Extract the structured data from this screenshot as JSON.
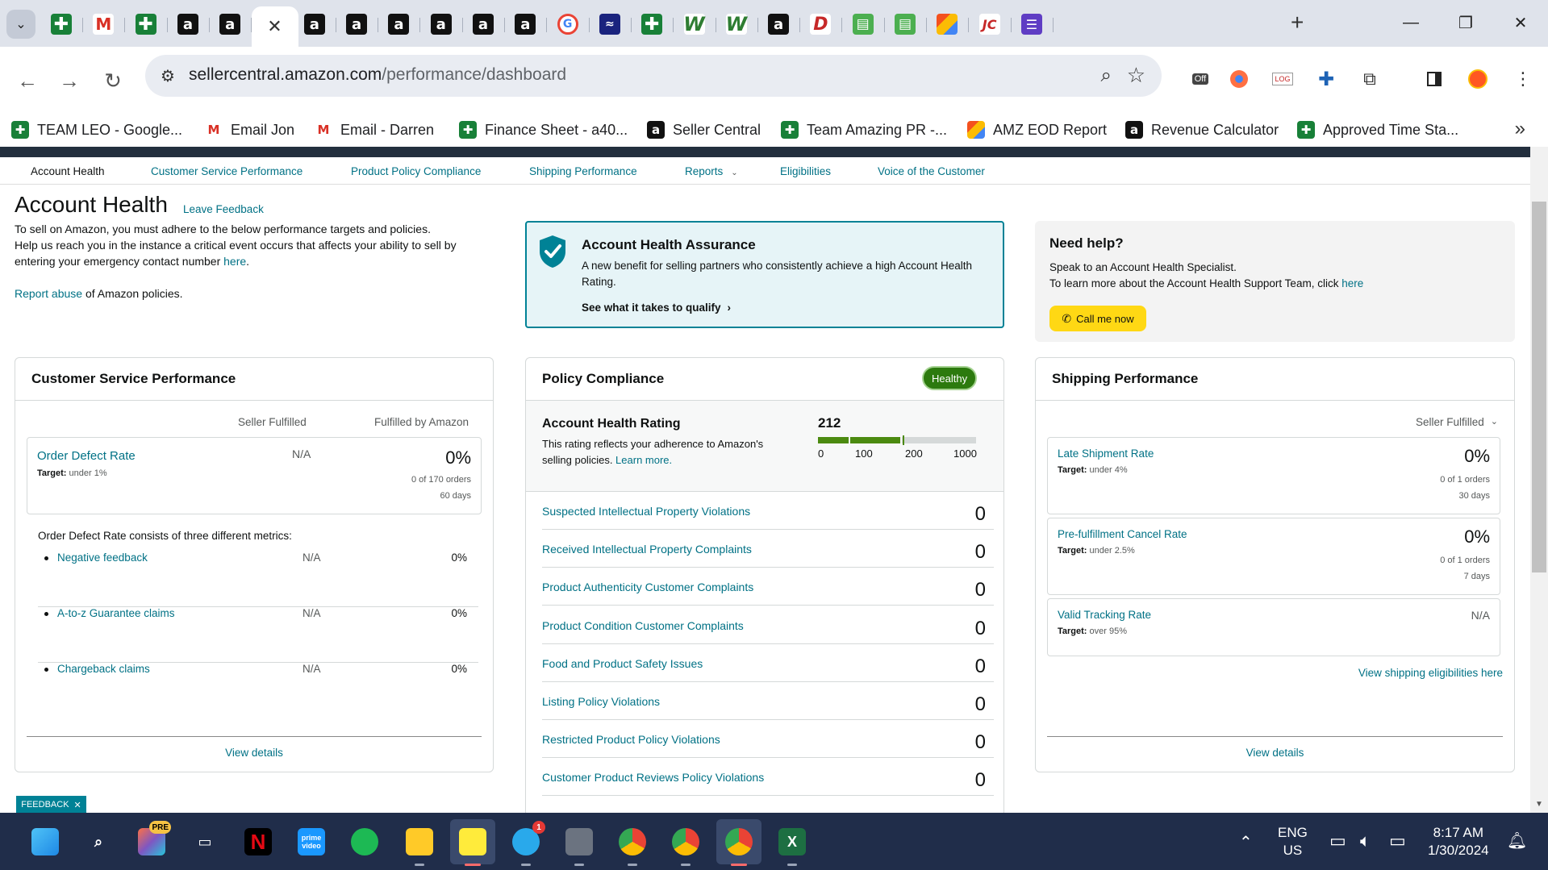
{
  "browser": {
    "tabs": [
      {
        "icon": "google-sheets-icon",
        "glyph": "✚",
        "style": "fav-sheets"
      },
      {
        "icon": "gmail-icon",
        "glyph": "M",
        "style": "fav-gmail"
      },
      {
        "icon": "google-sheets-icon",
        "glyph": "✚",
        "style": "fav-sheets"
      },
      {
        "icon": "amazon-icon",
        "glyph": "a",
        "style": "fav-amazon"
      },
      {
        "icon": "amazon-icon",
        "glyph": "a",
        "style": "fav-amazon"
      },
      {
        "icon": "active-tab",
        "glyph": "✕",
        "style": "tab-close",
        "active": true
      },
      {
        "icon": "amazon-icon",
        "glyph": "a",
        "style": "fav-amazon"
      },
      {
        "icon": "amazon-icon",
        "glyph": "a",
        "style": "fav-amazon"
      },
      {
        "icon": "amazon-icon",
        "glyph": "a",
        "style": "fav-amazon"
      },
      {
        "icon": "amazon-icon",
        "glyph": "a",
        "style": "fav-amazon"
      },
      {
        "icon": "amazon-icon",
        "glyph": "a",
        "style": "fav-amazon"
      },
      {
        "icon": "amazon-icon",
        "glyph": "a",
        "style": "fav-amazon"
      },
      {
        "icon": "google-icon",
        "glyph": "G",
        "style": "fav-google"
      },
      {
        "icon": "extension-icon",
        "glyph": "≈",
        "style": "fav-ext"
      },
      {
        "icon": "google-sheets-icon",
        "glyph": "✚",
        "style": "fav-sheets"
      },
      {
        "icon": "w-app-icon",
        "glyph": "W",
        "style": "fav-w"
      },
      {
        "icon": "w-app-icon",
        "glyph": "W",
        "style": "fav-w"
      },
      {
        "icon": "amazon-icon",
        "glyph": "a",
        "style": "fav-amazon"
      },
      {
        "icon": "d-app-icon",
        "glyph": "D",
        "style": "fav-d"
      },
      {
        "icon": "green-app-icon",
        "glyph": "▤",
        "style": "fav-green"
      },
      {
        "icon": "green-app-icon",
        "glyph": "▤",
        "style": "fav-green"
      },
      {
        "icon": "multicolor-app-icon",
        "glyph": "",
        "style": "fav-multi"
      },
      {
        "icon": "jc-app-icon",
        "glyph": "JC",
        "style": "fav-jc"
      },
      {
        "icon": "purple-list-icon",
        "glyph": "☰",
        "style": "fav-purple"
      }
    ],
    "url_host": "sellercentral.amazon.com",
    "url_path": "/performance/dashboard",
    "bookmarks": [
      {
        "label": "TEAM LEO - Google...",
        "icon": "google-sheets-icon",
        "glyph": "✚",
        "style": "fav-sheets"
      },
      {
        "label": "Email Jon",
        "icon": "gmail-icon",
        "glyph": "M",
        "style": "fav-gmail"
      },
      {
        "label": "Email - Darren",
        "icon": "gmail-icon",
        "glyph": "M",
        "style": "fav-gmail"
      },
      {
        "label": "Finance Sheet - a40...",
        "icon": "google-sheets-icon",
        "glyph": "✚",
        "style": "fav-sheets"
      },
      {
        "label": "Seller Central",
        "icon": "amazon-icon",
        "glyph": "a",
        "style": "fav-amazon"
      },
      {
        "label": "Team Amazing PR -...",
        "icon": "google-sheets-icon",
        "glyph": "✚",
        "style": "fav-sheets"
      },
      {
        "label": "AMZ EOD Report",
        "icon": "multicolor-app-icon",
        "glyph": "",
        "style": "fav-multi"
      },
      {
        "label": "Revenue Calculator",
        "icon": "amazon-icon",
        "glyph": "a",
        "style": "fav-amazon"
      },
      {
        "label": "Approved Time Sta...",
        "icon": "google-sheets-icon",
        "glyph": "✚",
        "style": "fav-sheets"
      }
    ],
    "extension_off_label": "Off"
  },
  "subnav": [
    {
      "label": "Account Health",
      "current": true
    },
    {
      "label": "Customer Service Performance"
    },
    {
      "label": "Product Policy Compliance"
    },
    {
      "label": "Shipping Performance"
    },
    {
      "label": "Reports",
      "dropdown": true
    },
    {
      "label": "Eligibilities"
    },
    {
      "label": "Voice of the Customer"
    }
  ],
  "header": {
    "title": "Account Health",
    "leave_feedback": "Leave Feedback",
    "intro_line1": "To sell on Amazon, you must adhere to the below performance targets and policies.",
    "intro_line2": "Help us reach you in the instance a critical event occurs that affects your ability to sell by",
    "intro_line3_pre": "entering your emergency contact number ",
    "intro_line3_link": "here",
    "intro_line3_post": ".",
    "report_abuse_link": "Report abuse",
    "report_abuse_rest": " of Amazon policies."
  },
  "aha": {
    "title": "Account Health Assurance",
    "description": "A new benefit for selling partners who consistently achieve a high Account Health Rating.",
    "cta": "See what it takes to qualify"
  },
  "need_help": {
    "title": "Need help?",
    "line1": "Speak to an Account Health Specialist.",
    "line2_pre": "To learn more about the Account Health Support Team, click ",
    "line2_link": "here",
    "button": "Call me now"
  },
  "csp": {
    "title": "Customer Service Performance",
    "col_seller": "Seller Fulfilled",
    "col_fba": "Fulfilled by Amazon",
    "odr_label": "Order Defect Rate",
    "odr_target_label": "Target:",
    "odr_target": " under 1%",
    "odr_seller": "N/A",
    "odr_fba": "0%",
    "odr_orders": "0 of 170 orders",
    "odr_days": "60 days",
    "metrics_intro": "Order Defect Rate consists of three different metrics:",
    "metrics": [
      {
        "label": "Negative feedback",
        "seller": "N/A",
        "fba": "0%"
      },
      {
        "label": "A-to-z Guarantee claims",
        "seller": "N/A",
        "fba": "0%"
      },
      {
        "label": "Chargeback claims",
        "seller": "N/A",
        "fba": "0%"
      }
    ],
    "view_details": "View details"
  },
  "policy": {
    "title": "Policy Compliance",
    "status": "Healthy",
    "rating_title": "Account Health Rating",
    "rating_value": "212",
    "rating_score": 212,
    "rating_desc1": "This rating reflects your adherence to Amazon's",
    "rating_desc2_pre": "selling policies. ",
    "rating_desc2_link": "Learn more.",
    "scale": [
      "0",
      "100",
      "200",
      "1000"
    ],
    "rows": [
      {
        "label": "Suspected Intellectual Property Violations",
        "value": "0"
      },
      {
        "label": "Received Intellectual Property Complaints",
        "value": "0"
      },
      {
        "label": "Product Authenticity Customer Complaints",
        "value": "0"
      },
      {
        "label": "Product Condition Customer Complaints",
        "value": "0"
      },
      {
        "label": "Food and Product Safety Issues",
        "value": "0"
      },
      {
        "label": "Listing Policy Violations",
        "value": "0"
      },
      {
        "label": "Restricted Product Policy Violations",
        "value": "0"
      },
      {
        "label": "Customer Product Reviews Policy Violations",
        "value": "0"
      }
    ],
    "colors": {
      "healthy_green": "#2c7a0e",
      "bar_gray": "#d5d9d9",
      "bar_green": "#4b8a10"
    }
  },
  "shipping": {
    "title": "Shipping Performance",
    "filter": "Seller Fulfilled",
    "tiles": [
      {
        "label": "Late Shipment Rate",
        "target_label": "Target:",
        "target": " under 4%",
        "value": "0%",
        "orders": "0 of 1 orders",
        "days": "30 days"
      },
      {
        "label": "Pre-fulfillment Cancel Rate",
        "target_label": "Target:",
        "target": " under 2.5%",
        "value": "0%",
        "orders": "0 of 1 orders",
        "days": "7 days"
      },
      {
        "label": "Valid Tracking Rate",
        "target_label": "Target:",
        "target": " over 95%",
        "value": "N/A"
      }
    ],
    "eligibilities_link": "View shipping eligibilities here",
    "view_details": "View details"
  },
  "feedback_tab": {
    "label": "FEEDBACK",
    "close": "✕"
  },
  "taskbar": {
    "apps": [
      {
        "name": "windows-start-icon"
      },
      {
        "name": "search-icon"
      },
      {
        "name": "copilot-icon",
        "badge": "PRE"
      },
      {
        "name": "task-view-icon"
      },
      {
        "name": "netflix-icon",
        "glyph": "N"
      },
      {
        "name": "prime-video-icon",
        "glyph": "prime video"
      },
      {
        "name": "spotify-icon"
      },
      {
        "name": "file-explorer-icon"
      },
      {
        "name": "sticky-notes-icon"
      },
      {
        "name": "telegram-icon",
        "badge": "1"
      },
      {
        "name": "calculator-icon"
      },
      {
        "name": "chrome-icon"
      },
      {
        "name": "chrome-profile-icon"
      },
      {
        "name": "chrome-active-icon"
      },
      {
        "name": "excel-icon",
        "glyph": "X"
      }
    ],
    "lang": "ENG",
    "region": "US",
    "time": "8:17 AM",
    "date": "1/30/2024"
  }
}
